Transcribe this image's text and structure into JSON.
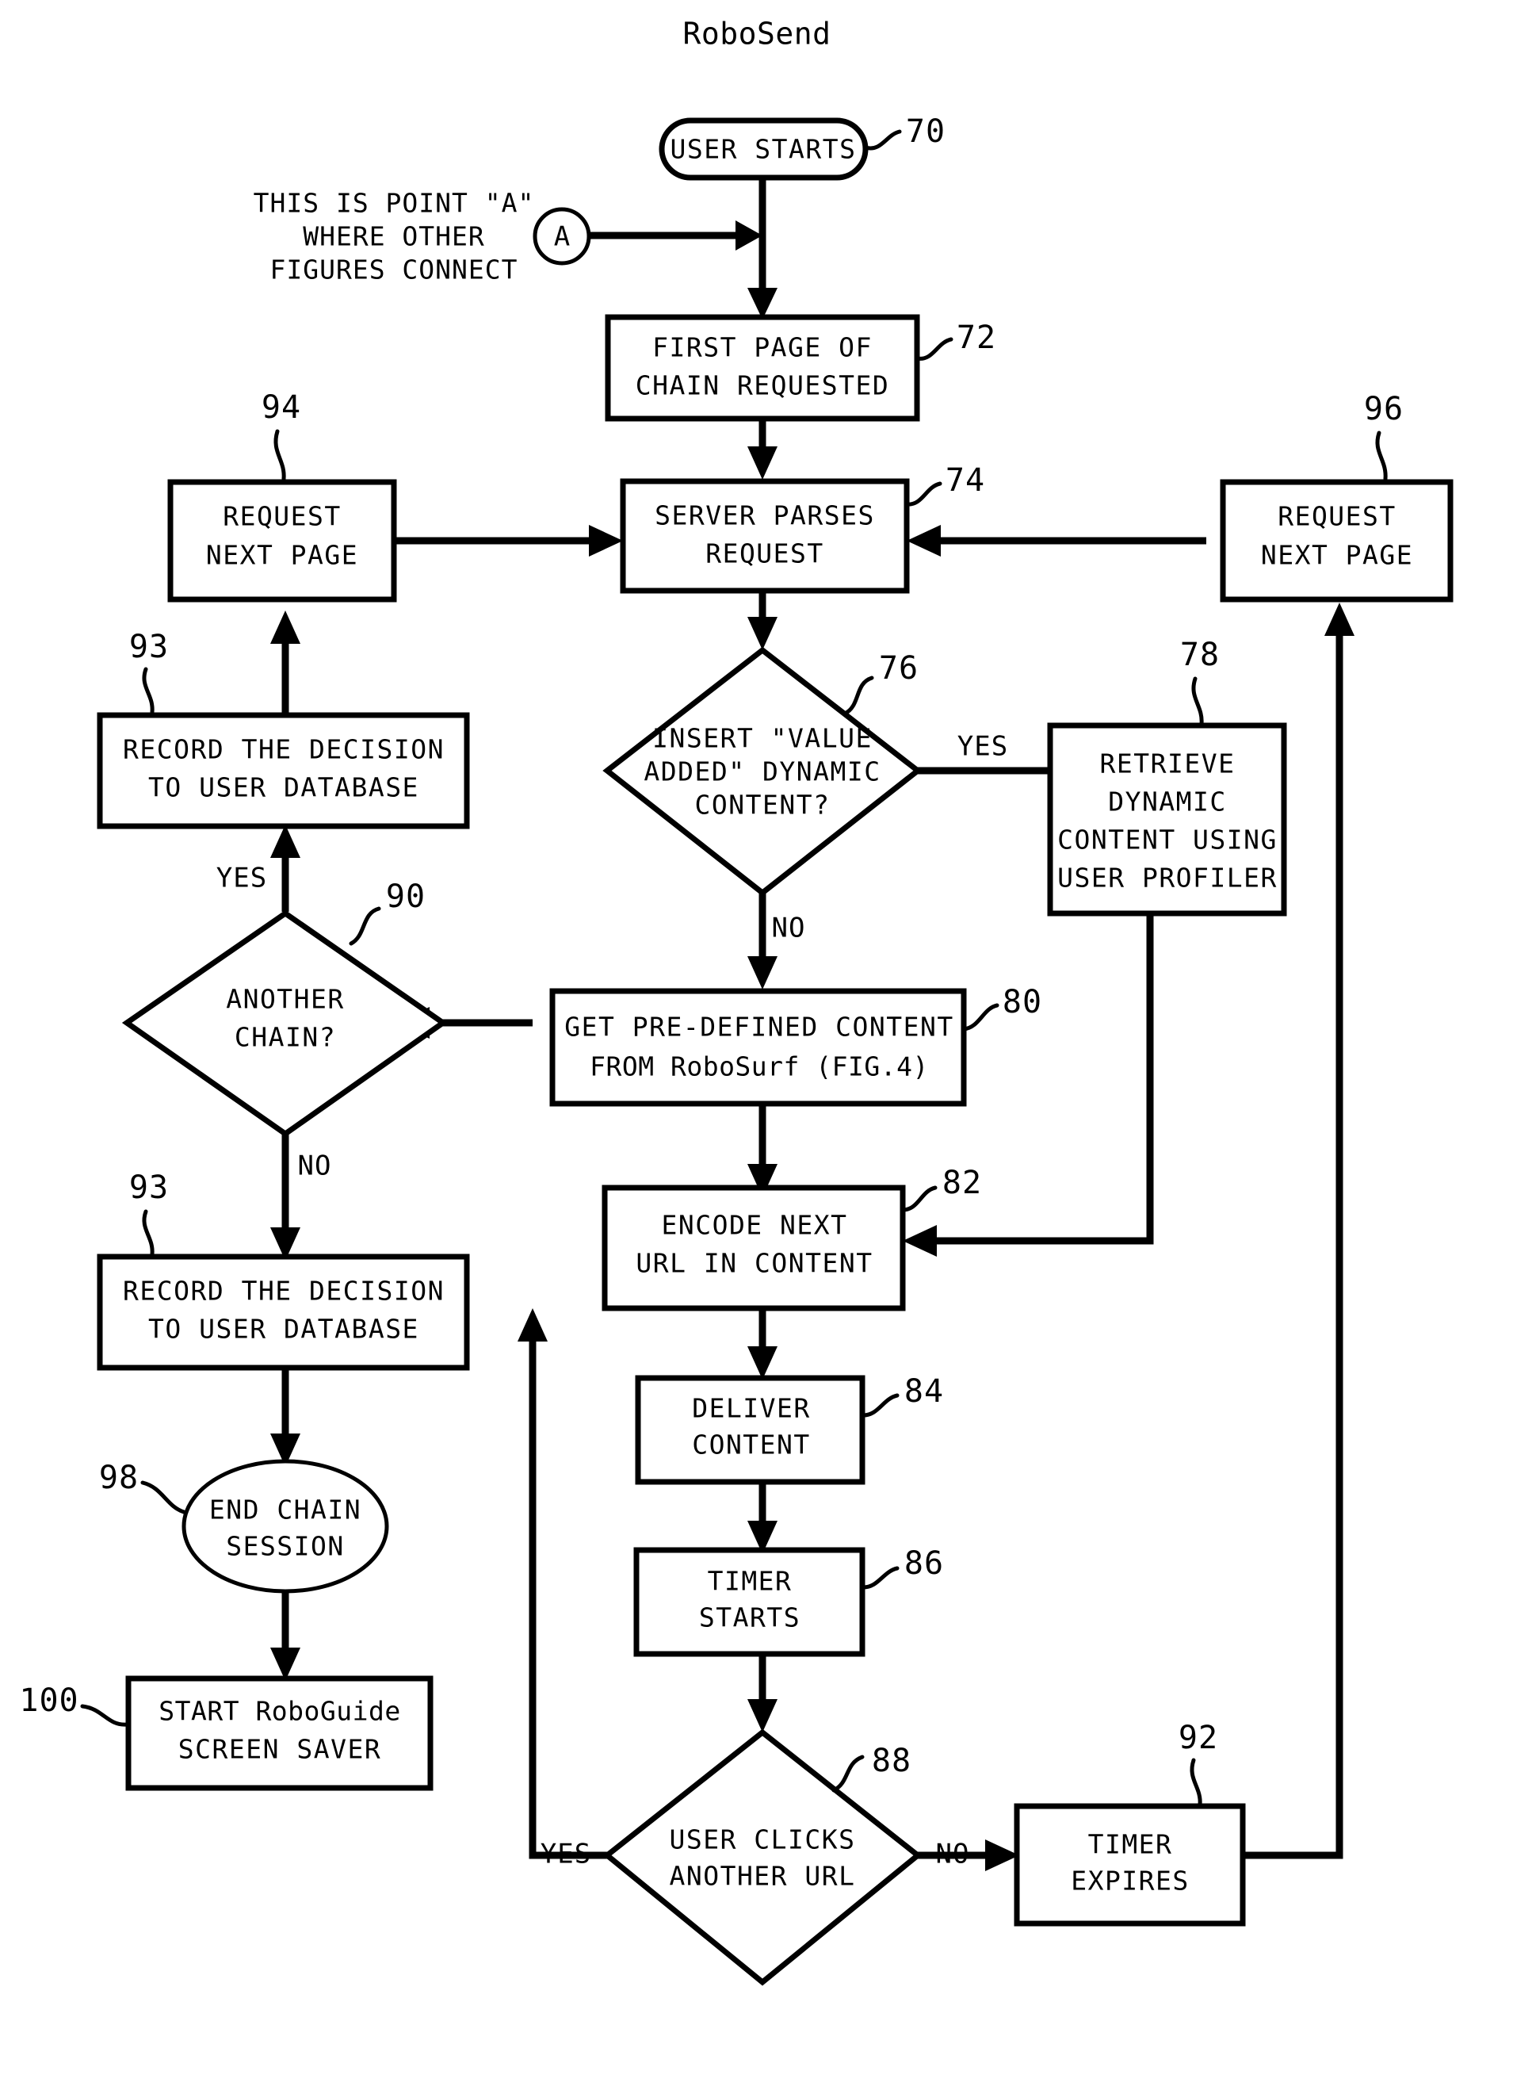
{
  "figure": {
    "title": "RoboSend",
    "annotation_note": {
      "line1": "THIS IS POINT \"A\"",
      "line2": "WHERE OTHER",
      "line3": "FIGURES CONNECT"
    },
    "connector_label": "A"
  },
  "nodes": {
    "user_starts": {
      "ref": "70",
      "line1": "USER STARTS"
    },
    "first_page": {
      "ref": "72",
      "line1": "FIRST PAGE OF",
      "line2": "CHAIN REQUESTED"
    },
    "server_parses": {
      "ref": "74",
      "line1": "SERVER PARSES",
      "line2": "REQUEST"
    },
    "insert_dynamic": {
      "ref": "76",
      "line1": "INSERT \"VALUE",
      "line2": "ADDED\" DYNAMIC",
      "line3": "CONTENT?"
    },
    "retrieve_dynamic": {
      "ref": "78",
      "line1": "RETRIEVE",
      "line2": "DYNAMIC",
      "line3": "CONTENT USING",
      "line4": "USER PROFILER"
    },
    "get_predefined": {
      "ref": "80",
      "line1": "GET PRE-DEFINED CONTENT",
      "line2": "FROM RoboSurf (FIG.4)"
    },
    "encode_next_url": {
      "ref": "82",
      "line1": "ENCODE NEXT",
      "line2": "URL IN CONTENT"
    },
    "deliver_content": {
      "ref": "84",
      "line1": "DELIVER",
      "line2": "CONTENT"
    },
    "timer_starts": {
      "ref": "86",
      "line1": "TIMER",
      "line2": "STARTS"
    },
    "user_clicks": {
      "ref": "88",
      "line1": "USER CLICKS",
      "line2": "ANOTHER URL"
    },
    "another_chain": {
      "ref": "90",
      "line1": "ANOTHER",
      "line2": "CHAIN?"
    },
    "timer_expires": {
      "ref": "92",
      "line1": "TIMER",
      "line2": "EXPIRES"
    },
    "record_decision_upper": {
      "ref": "93",
      "line1": "RECORD THE DECISION",
      "line2": "TO USER DATABASE"
    },
    "record_decision_lower": {
      "ref": "93",
      "line1": "RECORD THE DECISION",
      "line2": "TO USER DATABASE"
    },
    "request_next_page_left": {
      "ref": "94",
      "line1": "REQUEST",
      "line2": "NEXT PAGE"
    },
    "request_next_page_right": {
      "ref": "96",
      "line1": "REQUEST",
      "line2": "NEXT PAGE"
    },
    "end_chain_session": {
      "ref": "98",
      "line1": "END CHAIN",
      "line2": "SESSION"
    },
    "start_roboguide": {
      "ref": "100",
      "line1": "START RoboGuide",
      "line2": "SCREEN SAVER"
    }
  },
  "edge_labels": {
    "dynamic_yes": "YES",
    "dynamic_no": "NO",
    "chain_yes": "YES",
    "chain_no": "NO",
    "clicks_yes": "YES",
    "clicks_no": "NO"
  },
  "colors": {
    "ink": "#000000",
    "paper": "#ffffff"
  }
}
